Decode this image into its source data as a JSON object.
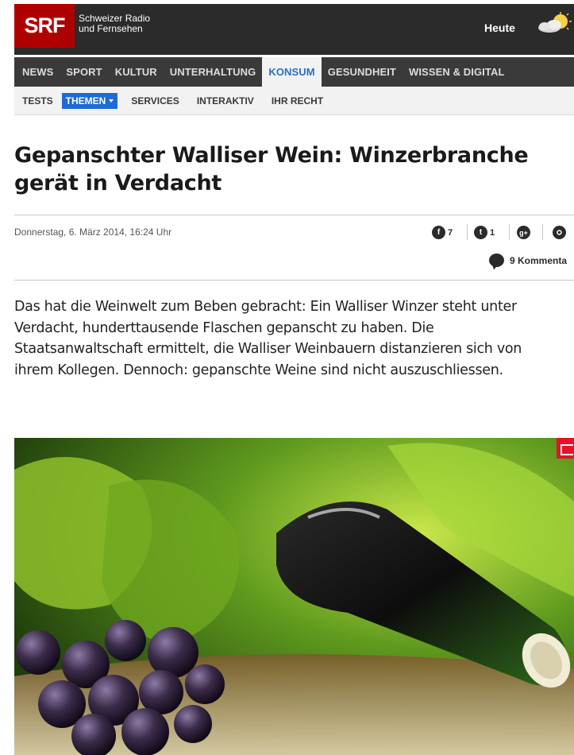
{
  "header": {
    "logo": "SRF",
    "brand_line1": "Schweizer Radio",
    "brand_line2": "und Fernsehen",
    "heute": "Heute"
  },
  "mainnav": [
    "NEWS",
    "SPORT",
    "KULTUR",
    "UNTERHALTUNG",
    "KONSUM",
    "GESUNDHEIT",
    "WISSEN & DIGITAL"
  ],
  "mainnav_active": "KONSUM",
  "subnav": [
    "TESTS",
    "THEMEN",
    "SERVICES",
    "INTERAKTIV",
    "IHR RECHT"
  ],
  "subnav_active": "THEMEN",
  "article": {
    "title": "Gepanschter Walliser Wein: Winzerbranche gerät in Verdacht",
    "date": "Donnerstag, 6. März 2014, 16:24 Uhr",
    "lead": "Das hat die Weinwelt zum Beben gebracht: Ein Walliser Winzer steht unter Verdacht, hunderttausende Flaschen gepanscht zu haben. Die Staatsanwaltschaft ermittelt, die Walliser Weinbauern distanzieren sich von ihrem Kollegen. Dennoch: gepanschte Weine sind nicht auszuschliessen."
  },
  "social": {
    "facebook_count": "7",
    "twitter_count": "1",
    "comments": "9 Kommenta"
  },
  "colors": {
    "brand_red": "#af0000",
    "active_blue": "#1e6ad6",
    "nav_dark": "#3a3a3a"
  }
}
